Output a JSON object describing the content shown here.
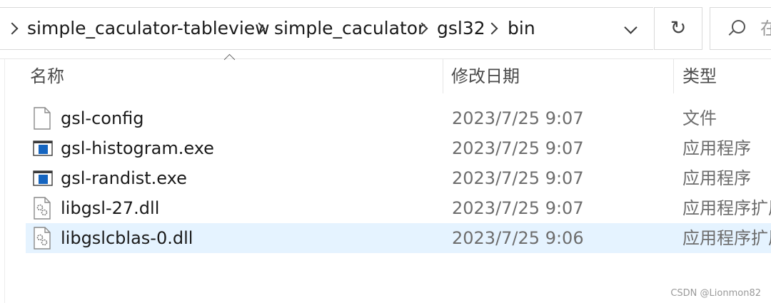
{
  "breadcrumb": [
    "simple_caculator-tableview",
    "simple_caculator",
    "gsl32",
    "bin"
  ],
  "search": {
    "placeholder": "在"
  },
  "columns": {
    "name": "名称",
    "date": "修改日期",
    "type": "类型"
  },
  "files": [
    {
      "name": "gsl-config",
      "date": "2023/7/25 9:07",
      "type": "文件",
      "icon": "file-icon"
    },
    {
      "name": "gsl-histogram.exe",
      "date": "2023/7/25 9:07",
      "type": "应用程序",
      "icon": "application-icon"
    },
    {
      "name": "gsl-randist.exe",
      "date": "2023/7/25 9:07",
      "type": "应用程序",
      "icon": "application-icon"
    },
    {
      "name": "libgsl-27.dll",
      "date": "2023/7/25 9:07",
      "type": "应用程序扩展",
      "icon": "dll-icon"
    },
    {
      "name": "libgslcblas-0.dll",
      "date": "2023/7/25 9:06",
      "type": "应用程序扩展",
      "icon": "dll-icon",
      "selected": true
    }
  ],
  "watermark": "CSDN @Lionmon82",
  "colors": {
    "selected_row": "#e5f3ff",
    "exe_blue": "#1565c0"
  }
}
